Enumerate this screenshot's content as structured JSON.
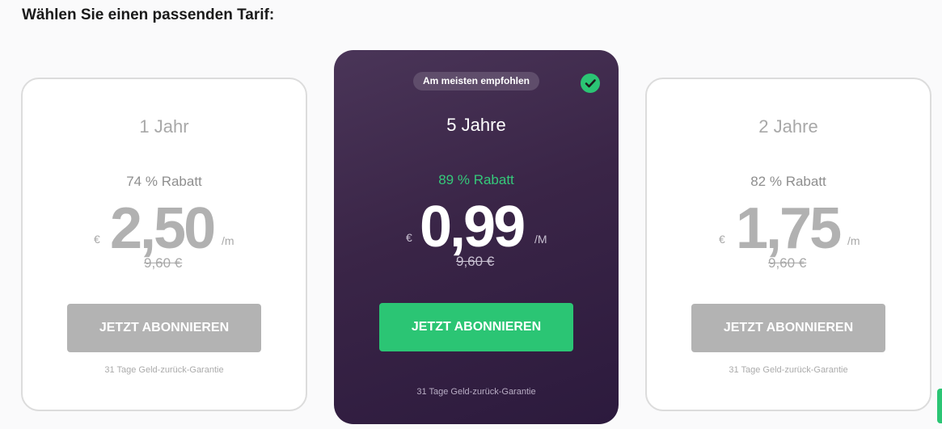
{
  "heading": "Wählen Sie einen passenden Tarif:",
  "plans": [
    {
      "period": "1 Jahr",
      "discount": "74 % Rabatt",
      "currency": "€",
      "amount": "2,50",
      "unit": "/m",
      "old_price": "9,60 €",
      "button": "JETZT ABONNIEREN",
      "guarantee": "31 Tage Geld-zurück-Garantie",
      "selected": false
    },
    {
      "badge": "Am meisten empfohlen",
      "period": "5 Jahre",
      "discount": "89 % Rabatt",
      "currency": "€",
      "amount": "0,99",
      "unit": "/M",
      "old_price": "9,60 €",
      "button": "JETZT ABONNIEREN",
      "guarantee": "31 Tage Geld-zurück-Garantie",
      "selected": true
    },
    {
      "period": "2 Jahre",
      "discount": "82 % Rabatt",
      "currency": "€",
      "amount": "1,75",
      "unit": "/m",
      "old_price": "9,60 €",
      "button": "JETZT ABONNIEREN",
      "guarantee": "31 Tage Geld-zurück-Garantie",
      "selected": false
    }
  ],
  "icons": {
    "selected_indicator": "checkmark-circle-icon"
  },
  "colors": {
    "accent_green": "#2bc574",
    "featured_card_bg": "#3a2547",
    "inactive_button": "#b3b3b3",
    "discount_green": "#35c97a"
  }
}
